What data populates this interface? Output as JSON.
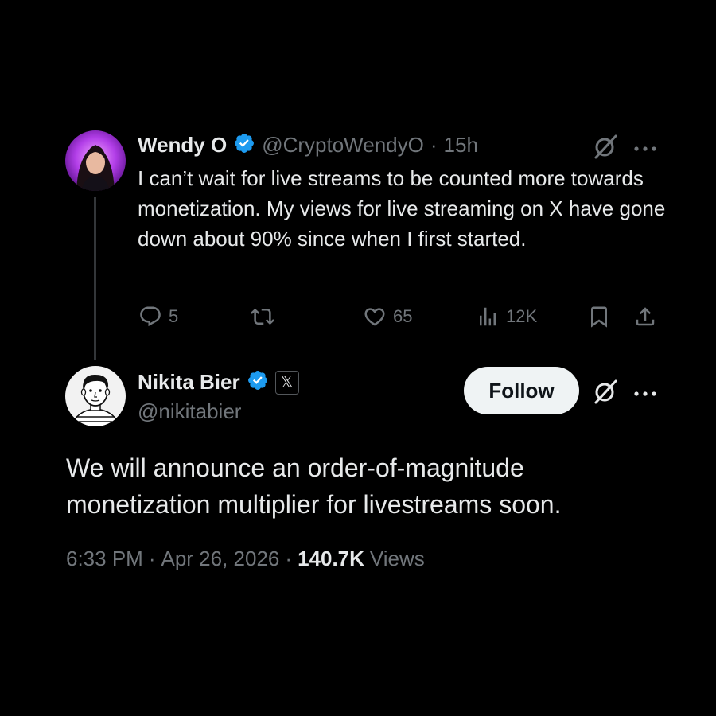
{
  "parent_tweet": {
    "author_name": "Wendy O",
    "handle": "@CryptoWendyO",
    "separator": "·",
    "time": "15h",
    "text": "I can’t wait for live streams to be counted more towards monetization. My views for live streaming on X have gone down about 90% since when I first started.",
    "actions": {
      "replies": "5",
      "reposts": "",
      "likes": "65",
      "views": "12K"
    }
  },
  "reply_tweet": {
    "author_name": "Nikita Bier",
    "handle": "@nikitabier",
    "affiliate_badge": "𝕏",
    "follow_label": "Follow",
    "text": "We will announce an order-of-magnitude monetization multiplier for livestreams soon.",
    "meta": {
      "time": "6:33 PM",
      "separator_1": "·",
      "date": "Apr 26, 2026",
      "separator_2": "·",
      "views_count": "140.7K",
      "views_label": "Views"
    }
  },
  "icons": {
    "verified": "verified-badge-icon",
    "grok": "grok-icon",
    "more": "more-icon",
    "reply": "reply-icon",
    "repost": "repost-icon",
    "like": "like-icon",
    "views": "views-icon",
    "bookmark": "bookmark-icon",
    "share": "share-icon"
  },
  "colors": {
    "background": "#000000",
    "text_primary": "#e7e9ea",
    "text_secondary": "#71767b",
    "verified_blue": "#1d9bf0",
    "follow_button_bg": "#eff3f4"
  }
}
